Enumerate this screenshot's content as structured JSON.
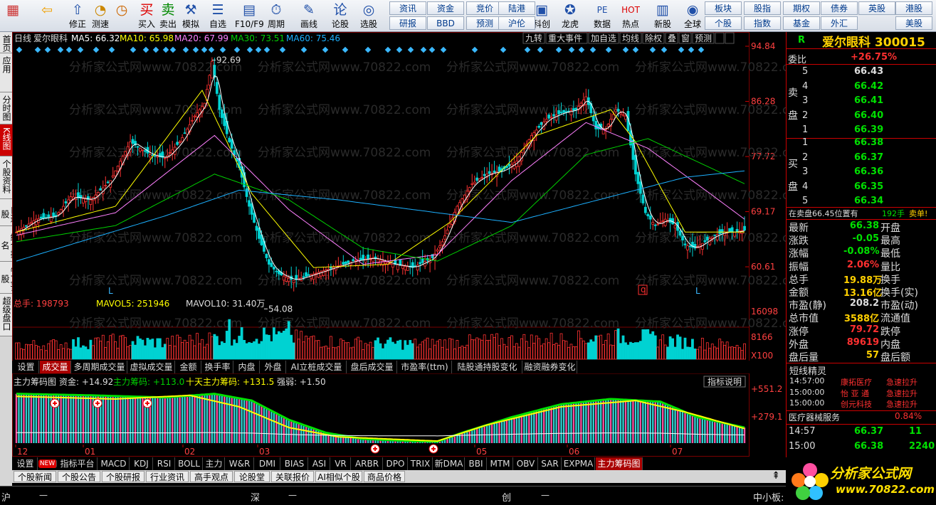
{
  "toolbar": {
    "buttons": [
      {
        "label": "",
        "icon": "app-grid-icon",
        "name": "app-menu-button"
      },
      {
        "label": "",
        "icon": "back-arrow-icon",
        "name": "back-button"
      },
      {
        "label": "修正",
        "icon": "up-arrow-icon",
        "name": "revise-button"
      },
      {
        "label": "测速",
        "icon": "speed-icon",
        "name": "speed-test-button"
      },
      {
        "label": "",
        "icon": "clock-icon",
        "name": "clock-button"
      },
      {
        "label": "买入",
        "icon": "buy-icon",
        "name": "buy-button",
        "glyph": "买"
      },
      {
        "label": "卖出",
        "icon": "sell-icon",
        "name": "sell-button",
        "glyph": "卖"
      },
      {
        "label": "模拟",
        "icon": "hammer-icon",
        "name": "simulate-button"
      },
      {
        "label": "自选",
        "icon": "watchlist-icon",
        "name": "watchlist-button"
      },
      {
        "label": "F10/F9",
        "icon": "f10-icon",
        "name": "f10-button"
      },
      {
        "label": "周期",
        "icon": "period-icon",
        "name": "period-button"
      },
      {
        "label": "画线",
        "icon": "pencil-icon",
        "name": "draw-line-button"
      },
      {
        "label": "论股",
        "icon": "discuss-icon",
        "name": "discuss-button"
      },
      {
        "label": "选股",
        "icon": "stock-picker-icon",
        "name": "stock-pick-button"
      },
      {
        "label": "科创",
        "icon": "kechuang-icon",
        "name": "kechuang-button"
      },
      {
        "label": "龙虎",
        "icon": "dragon-tiger-icon",
        "name": "dragon-tiger-button"
      },
      {
        "label": "数据",
        "icon": "pe-data-icon",
        "name": "data-button",
        "glyph": "PE"
      },
      {
        "label": "热点",
        "icon": "hot-icon",
        "name": "hot-button",
        "glyph": "HOT"
      },
      {
        "label": "新股",
        "icon": "new-stock-icon",
        "name": "new-stock-button"
      },
      {
        "label": "全球",
        "icon": "globe-icon",
        "name": "global-button"
      }
    ],
    "small": [
      "资讯",
      "资金",
      "竞价",
      "陆港",
      "研报",
      "BBD",
      "预测",
      "沪伦",
      "板块",
      "股指",
      "期权",
      "债券",
      "英股",
      "港股",
      "个股",
      "指数",
      "基金",
      "外汇",
      "美股"
    ]
  },
  "leftnav": [
    "首页",
    "应用",
    "分时图",
    "K线图",
    "个股资料",
    "自选股",
    "综合排名",
    "牛叉诊股",
    "超级盘口"
  ],
  "header": {
    "period": "日线",
    "name": "爱尔眼科",
    "ma5": "MA5: 66.32",
    "ma10": "MA10: 65.98",
    "ma20": "MA20: 67.99",
    "ma30": "MA30: 73.51",
    "ma60": "MA60: 75.46",
    "buttons": [
      "九转",
      "重大事件",
      "加自选",
      "均线",
      "除权",
      "叠",
      "窗",
      "预测"
    ]
  },
  "colors": {
    "up": "#ff3232",
    "down": "#00d2d2",
    "ma5": "#ffffff",
    "ma10": "#ffff00",
    "ma20": "#ff80ff",
    "ma30": "#00d000",
    "ma60": "#1cb0ff",
    "grid": "#7a0000",
    "accent": "#c00000"
  },
  "watermark": "分析家公式网www.70822.com",
  "chart_data": {
    "type": "candlestick",
    "price_axis": {
      "ticks": [
        94.84,
        86.28,
        77.72,
        69.17,
        60.61
      ],
      "range": [
        54,
        94.84
      ]
    },
    "annotations": {
      "high": "92.69",
      "low": "54.08"
    },
    "x_ticks": [
      "12",
      "01",
      "02",
      "03",
      "05",
      "06",
      "07"
    ],
    "markers": {
      "L1": "L",
      "L2": "L",
      "Q": "q"
    },
    "volume": {
      "summary": "总手: 198793",
      "mavol5": "MAVOL5: 251946",
      "mavol10": "MAVOL10: 31.40万",
      "ticks": [
        "16098",
        "8166",
        "X100"
      ]
    },
    "indicator": {
      "title": "主力筹码图",
      "v1": "资金: +14.92",
      "v2": "主力筹码: +113.0",
      "v3": "十天主力筹码: +131.5",
      "v4": "强弱: +1.50",
      "ticks": [
        "+551.2",
        "+279.1"
      ],
      "explain": "指标说明"
    },
    "series_keypoints": {
      "price": [
        [
          0,
          66
        ],
        [
          8,
          68
        ],
        [
          16,
          68.5
        ],
        [
          22,
          71.5
        ],
        [
          30,
          71
        ],
        [
          38,
          74
        ],
        [
          46,
          80
        ],
        [
          54,
          78
        ],
        [
          60,
          77.5
        ],
        [
          66,
          80
        ],
        [
          72,
          84
        ],
        [
          76,
          86
        ],
        [
          79,
          92.5
        ],
        [
          82,
          85
        ],
        [
          86,
          80
        ],
        [
          90,
          76
        ],
        [
          94,
          70
        ],
        [
          98,
          65
        ],
        [
          102,
          61
        ],
        [
          106,
          59.5
        ],
        [
          112,
          58.5
        ],
        [
          120,
          59.5
        ],
        [
          128,
          60.5
        ],
        [
          136,
          61.5
        ],
        [
          144,
          62
        ],
        [
          152,
          61
        ],
        [
          160,
          60.5
        ],
        [
          168,
          62
        ],
        [
          172,
          64.5
        ],
        [
          178,
          70
        ],
        [
          184,
          73.5
        ],
        [
          190,
          75
        ],
        [
          196,
          75.5
        ],
        [
          202,
          77
        ],
        [
          208,
          81
        ],
        [
          214,
          83.5
        ],
        [
          220,
          84.5
        ],
        [
          226,
          85
        ],
        [
          230,
          87
        ],
        [
          234,
          82
        ],
        [
          238,
          82
        ],
        [
          242,
          85
        ],
        [
          246,
          84
        ],
        [
          250,
          75
        ],
        [
          254,
          69
        ],
        [
          258,
          67
        ],
        [
          262,
          68
        ],
        [
          266,
          67
        ],
        [
          270,
          64
        ],
        [
          274,
          63.5
        ],
        [
          278,
          64.5
        ],
        [
          282,
          65.5
        ],
        [
          286,
          66
        ],
        [
          290,
          66
        ],
        [
          294,
          66.3
        ]
      ],
      "ma60": [
        [
          0,
          61.5
        ],
        [
          60,
          68.5
        ],
        [
          90,
          72.5
        ],
        [
          130,
          71
        ],
        [
          170,
          69
        ],
        [
          200,
          67.5
        ],
        [
          240,
          71.5
        ],
        [
          270,
          74.5
        ],
        [
          294,
          75.5
        ]
      ],
      "ma30": [
        [
          0,
          64.5
        ],
        [
          40,
          67
        ],
        [
          80,
          75
        ],
        [
          110,
          71
        ],
        [
          140,
          63.5
        ],
        [
          170,
          61.5
        ],
        [
          200,
          67
        ],
        [
          230,
          78
        ],
        [
          255,
          80.5
        ],
        [
          294,
          73.5
        ]
      ],
      "ma20": [
        [
          0,
          65.5
        ],
        [
          40,
          69
        ],
        [
          80,
          81
        ],
        [
          110,
          69.5
        ],
        [
          140,
          61
        ],
        [
          170,
          62.5
        ],
        [
          200,
          74
        ],
        [
          230,
          83
        ],
        [
          255,
          79
        ],
        [
          280,
          72
        ],
        [
          294,
          68
        ]
      ],
      "ma10": [
        [
          0,
          66
        ],
        [
          40,
          70
        ],
        [
          75,
          88
        ],
        [
          95,
          72
        ],
        [
          120,
          60.5
        ],
        [
          150,
          61
        ],
        [
          175,
          67.5
        ],
        [
          210,
          81
        ],
        [
          240,
          85
        ],
        [
          250,
          80
        ],
        [
          270,
          66
        ],
        [
          294,
          66
        ]
      ],
      "vol": [
        [
          0,
          45
        ],
        [
          20,
          50
        ],
        [
          40,
          60
        ],
        [
          60,
          55
        ],
        [
          80,
          70
        ],
        [
          100,
          80
        ],
        [
          130,
          55
        ],
        [
          160,
          50
        ],
        [
          190,
          60
        ],
        [
          220,
          65
        ],
        [
          250,
          75
        ],
        [
          270,
          55
        ],
        [
          294,
          45
        ]
      ],
      "ind_a": [
        [
          0,
          95
        ],
        [
          30,
          92
        ],
        [
          60,
          88
        ],
        [
          80,
          95
        ],
        [
          95,
          82
        ],
        [
          110,
          45
        ],
        [
          125,
          20
        ],
        [
          140,
          8
        ],
        [
          160,
          4
        ],
        [
          170,
          3
        ],
        [
          180,
          20
        ],
        [
          200,
          50
        ],
        [
          220,
          75
        ],
        [
          240,
          85
        ],
        [
          260,
          80
        ],
        [
          275,
          50
        ],
        [
          294,
          30
        ]
      ],
      "ind_b": [
        [
          0,
          90
        ],
        [
          40,
          85
        ],
        [
          70,
          92
        ],
        [
          90,
          70
        ],
        [
          110,
          30
        ],
        [
          130,
          12
        ],
        [
          170,
          4
        ],
        [
          190,
          35
        ],
        [
          220,
          70
        ],
        [
          250,
          82
        ],
        [
          270,
          60
        ],
        [
          294,
          28
        ]
      ]
    }
  },
  "tabs_vol": [
    "设置",
    "成交量",
    "多周期成交量",
    "虚拟成交量",
    "金额",
    "换手率",
    "内盘",
    "外盘",
    "AI立桩成交量",
    "盘后成交量",
    "市盈率(ttm)",
    "陆股通持股变化",
    "融资融券变化"
  ],
  "tabs_ind": [
    "设置",
    "NEW",
    "指标平台",
    "MACD",
    "KDJ",
    "RSI",
    "BOLL",
    "主力",
    "W&R",
    "DMI",
    "BIAS",
    "ASI",
    "VR",
    "ARBR",
    "DPO",
    "TRIX",
    "新DMA",
    "BBI",
    "MTM",
    "OBV",
    "SAR",
    "EXPMA",
    "主力筹码图"
  ],
  "news": [
    "个股新闻",
    "个股公告",
    "个股研报",
    "行业资讯",
    "高手观点",
    "论股堂",
    "关联报价",
    "AI相似个股",
    "商品价格"
  ],
  "right": {
    "badge": "R",
    "name": "爱尔眼科 300015",
    "weibi_label": "委比",
    "weibi": "+26.75%",
    "sell_label": "卖盘",
    "buy_label": "买盘",
    "sells": [
      {
        "n": "5",
        "p": "66.43"
      },
      {
        "n": "4",
        "p": "66.42"
      },
      {
        "n": "3",
        "p": "66.41"
      },
      {
        "n": "2",
        "p": "66.40"
      },
      {
        "n": "1",
        "p": "66.39"
      }
    ],
    "buys": [
      {
        "n": "1",
        "p": "66.38"
      },
      {
        "n": "2",
        "p": "66.37"
      },
      {
        "n": "3",
        "p": "66.36"
      },
      {
        "n": "4",
        "p": "66.35"
      },
      {
        "n": "5",
        "p": "66.34"
      }
    ],
    "notice": "在卖盘66.45位置有",
    "notice_qty": "192手",
    "notice_tail": "卖单!",
    "stats": [
      {
        "l1": "最新",
        "v1": "66.38",
        "l2": "开盘"
      },
      {
        "l1": "涨跌",
        "v1": "-0.05",
        "l2": "最高"
      },
      {
        "l1": "涨幅",
        "v1": "-0.08%",
        "l2": "最低"
      },
      {
        "l1": "振幅",
        "v1": "2.06%",
        "l2": "量比"
      },
      {
        "l1": "总手",
        "v1": "19.88万",
        "l2": "换手"
      },
      {
        "l1": "金额",
        "v1": "13.16亿",
        "l2": "换手(实)"
      },
      {
        "l1": "市盈(静)",
        "v1": "208.2",
        "l2": "市盈(动)"
      },
      {
        "l1": "总市值",
        "v1": "3588亿",
        "l2": "流通值"
      },
      {
        "l1": "涨停",
        "v1": "79.72",
        "l2": "跌停"
      },
      {
        "l1": "外盘",
        "v1": "89619",
        "l2": "内盘"
      },
      {
        "l1": "盘后量",
        "v1": "57",
        "l2": "盘后额"
      }
    ],
    "short_title": "短线精灵",
    "short_items": [
      {
        "t": "14:57:00",
        "n": "康拓医疗",
        "e": "急速拉升"
      },
      {
        "t": "15:00:00",
        "n": "怡 亚 通",
        "e": "急速拉升"
      },
      {
        "t": "15:00:00",
        "n": "创元科技",
        "e": "急速拉升"
      }
    ],
    "sector": "医疗器械服务",
    "sector_pct": "0.84%",
    "ticks": [
      {
        "t": "14:57",
        "p": "66.37",
        "v": "11"
      },
      {
        "t": "15:00",
        "p": "66.38",
        "v": "2240"
      }
    ]
  },
  "status": {
    "sh": "沪",
    "sz": "深",
    "cy": "创",
    "dash": "—",
    "small": "中小板:"
  },
  "logo": {
    "text": "分析家公式网",
    "url": "www.70822.com"
  }
}
